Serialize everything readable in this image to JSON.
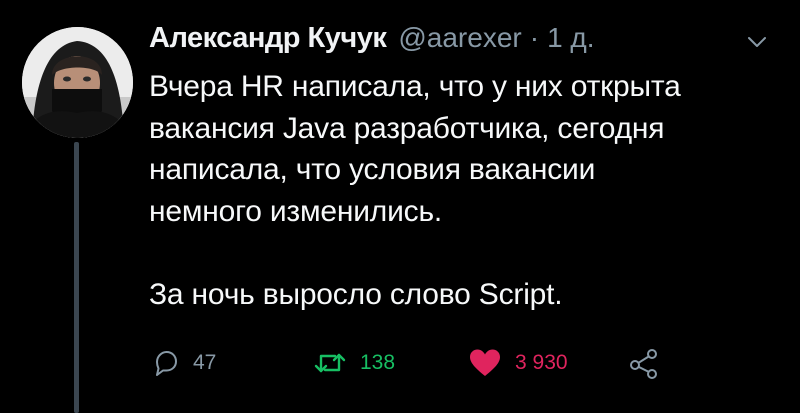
{
  "tweet": {
    "author": "Александр Кучук",
    "handle": "@aarexer",
    "separator": "·",
    "time": "1 д.",
    "lines": [
      "Вчера HR написала, что у них открыта",
      "вакансия Java разработчика, сегодня",
      "написала, что условия вакансии",
      "немного изменились."
    ],
    "final_line": "За ночь выросло слово Script."
  },
  "actions": {
    "reply_count": "47",
    "retweet_count": "138",
    "like_count": "3 930"
  },
  "icons": {
    "menu": "chevron-down-icon",
    "reply": "reply-icon",
    "retweet": "retweet-icon",
    "like": "heart-icon",
    "share": "share-icon"
  },
  "colors": {
    "background": "#000000",
    "text": "#f7f9fa",
    "muted": "#8899a6",
    "retweet": "#17bf63",
    "like": "#e0245e"
  }
}
